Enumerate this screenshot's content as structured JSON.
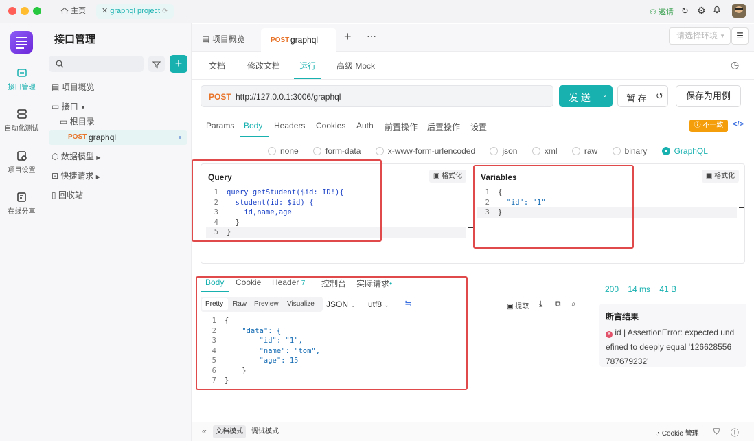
{
  "titlebar": {
    "home_label": "主页",
    "project_tab": "graphql project",
    "invite_label": "邀请"
  },
  "rail": {
    "items": [
      {
        "label": "接口管理",
        "icon": "api-icon"
      },
      {
        "label": "自动化测试",
        "icon": "automation-icon"
      },
      {
        "label": "项目设置",
        "icon": "settings-icon"
      },
      {
        "label": "在线分享",
        "icon": "share-icon"
      }
    ]
  },
  "tree": {
    "title": "接口管理",
    "items": [
      {
        "label": "项目概览",
        "icon": "overview-icon"
      },
      {
        "label": "接口",
        "icon": "folder-icon"
      },
      {
        "label": "根目录",
        "icon": "folder-open-icon"
      },
      {
        "method": "POST",
        "label": "graphql"
      },
      {
        "label": "数据模型",
        "icon": "model-icon"
      },
      {
        "label": "快捷请求",
        "icon": "quick-icon"
      },
      {
        "label": "回收站",
        "icon": "trash-icon"
      }
    ]
  },
  "doc_tabs": {
    "overview": "项目概览",
    "active_method": "POST",
    "active_name": "graphql",
    "env_placeholder": "请选择环境"
  },
  "sub_tabs": [
    "文档",
    "修改文档",
    "运行",
    "高级 Mock"
  ],
  "request": {
    "method": "POST",
    "url": "http://127.0.0.1:3006/graphql",
    "send_label": "发 送",
    "save_label": "暂 存",
    "save_case_label": "保存为用例"
  },
  "param_tabs": [
    "Params",
    "Body",
    "Headers",
    "Cookies",
    "Auth",
    "前置操作",
    "后置操作",
    "设置"
  ],
  "mismatch_badge": "不一致",
  "body_types": [
    "none",
    "form-data",
    "x-www-form-urlencoded",
    "json",
    "xml",
    "raw",
    "binary",
    "GraphQL"
  ],
  "query_panel": {
    "title": "Query",
    "format_label": "格式化",
    "lines": [
      {
        "n": "1",
        "text": "query getStudent($id: ID!){"
      },
      {
        "n": "2",
        "text": "  student(id: $id) {"
      },
      {
        "n": "3",
        "text": "    id,name,age"
      },
      {
        "n": "4",
        "text": "  }"
      },
      {
        "n": "5",
        "text": "}"
      }
    ]
  },
  "variables_panel": {
    "title": "Variables",
    "format_label": "格式化",
    "lines": [
      {
        "n": "1",
        "text": "{"
      },
      {
        "n": "2",
        "text": "  \"id\": \"1\""
      },
      {
        "n": "3",
        "text": "}"
      }
    ]
  },
  "response_tabs": [
    "Body",
    "Cookie",
    "Header",
    "控制台",
    "实际请求"
  ],
  "header_count": "7",
  "view_modes": [
    "Pretty",
    "Raw",
    "Preview",
    "Visualize"
  ],
  "format_select": "JSON",
  "encoding_select": "utf8",
  "extract_label": "提取",
  "response_lines": [
    {
      "n": "1",
      "text": "{"
    },
    {
      "n": "2",
      "text": "    \"data\": {"
    },
    {
      "n": "3",
      "text": "        \"id\": \"1\","
    },
    {
      "n": "4",
      "text": "        \"name\": \"tom\","
    },
    {
      "n": "5",
      "text": "        \"age\": 15"
    },
    {
      "n": "6",
      "text": "    }"
    },
    {
      "n": "7",
      "text": "}"
    }
  ],
  "status": {
    "code": "200",
    "time": "14 ms",
    "size": "41 B"
  },
  "assertion": {
    "title": "断言结果",
    "line1": "id | AssertionError: expected und",
    "line2": "efined to deeply equal '126628556",
    "line3": "787679232'"
  },
  "footer": {
    "doc_mode": "文档模式",
    "debug_mode": "调试模式",
    "cookie_manage": "Cookie 管理"
  },
  "colors": {
    "accent": "#19b1b0",
    "post": "#e8742a",
    "annotation": "#e04a4a"
  }
}
